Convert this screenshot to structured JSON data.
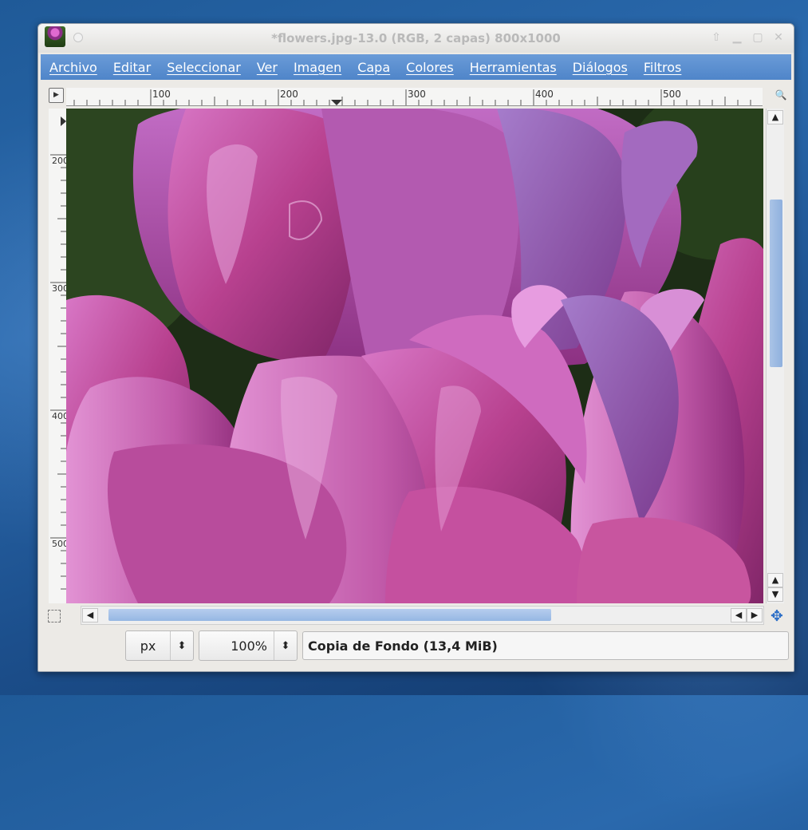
{
  "window": {
    "title": "*flowers.jpg-13.0 (RGB, 2 capas) 800x1000"
  },
  "menubar": {
    "items": [
      "Archivo",
      "Editar",
      "Seleccionar",
      "Ver",
      "Imagen",
      "Capa",
      "Colores",
      "Herramientas",
      "Diálogos",
      "Filtros"
    ]
  },
  "rulers": {
    "horizontal_labels": [
      "100",
      "200",
      "300",
      "400",
      "500"
    ],
    "vertical_labels": [
      "200",
      "300",
      "400",
      "500"
    ]
  },
  "statusbar": {
    "unit": "px",
    "zoom": "100%",
    "layer_info": "Copia de Fondo (13,4 MiB)"
  },
  "icons": {
    "app": "gimp-wilber-icon",
    "navigate": "move-cross-icon",
    "zoom_toggle": "magnifier-icon",
    "ruler_menu": "triangle-right-icon"
  },
  "colors": {
    "menubar": "#5b8fd0",
    "scroll_thumb": "#9db9e2",
    "petal": "#b8418f"
  },
  "scroll": {
    "vertical_position": 0.25,
    "horizontal_position": 0.05
  }
}
